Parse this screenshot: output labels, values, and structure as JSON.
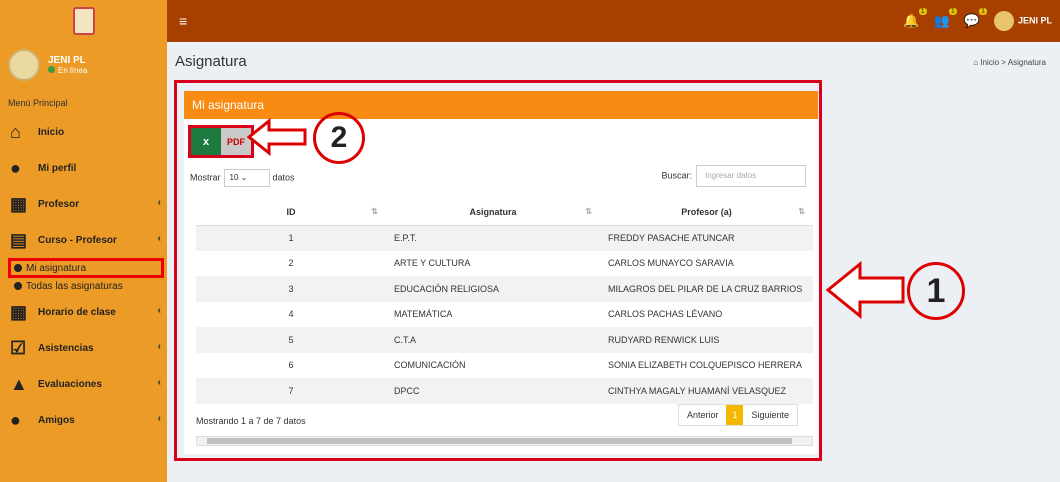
{
  "header": {
    "user": "JENI PL",
    "badges": [
      "1",
      "1",
      "1"
    ]
  },
  "sidebar": {
    "user_name": "JENI PL",
    "status": "En línea",
    "menu_title": "Menú Principal",
    "items": [
      {
        "label": "Inicio"
      },
      {
        "label": "Mi perfil"
      },
      {
        "label": "Profesor"
      },
      {
        "label": "Curso - Profesor"
      },
      {
        "label": "Horario de clase"
      },
      {
        "label": "Asistencias"
      },
      {
        "label": "Evaluaciones"
      },
      {
        "label": "Amigos"
      }
    ],
    "sub_items": [
      {
        "label": "Mi asignatura"
      },
      {
        "label": "Todas las asignaturas"
      }
    ]
  },
  "page": {
    "title": "Asignatura",
    "breadcrumb_home": "Inicio",
    "breadcrumb_current": "Asignatura"
  },
  "card": {
    "title": "Mi asignatura",
    "show_label": "Mostrar",
    "show_value": "10",
    "show_suffix": "datos",
    "search_label": "Buscar:",
    "search_placeholder": "Ingresar datos",
    "columns": [
      "ID",
      "Asignatura",
      "Profesor (a)"
    ],
    "rows": [
      {
        "id": "1",
        "asignatura": "E.P.T.",
        "profesor": "FREDDY PASACHE ATUNCAR"
      },
      {
        "id": "2",
        "asignatura": "ARTE Y CULTURA",
        "profesor": "CARLOS MUNAYCO SARAVIA"
      },
      {
        "id": "3",
        "asignatura": "EDUCACIÓN RELIGIOSA",
        "profesor": "MILAGROS DEL PILAR DE LA CRUZ BARRIOS"
      },
      {
        "id": "4",
        "asignatura": "MATEMÁTICA",
        "profesor": "CARLOS PACHAS LÉVANO"
      },
      {
        "id": "5",
        "asignatura": "C.T.A",
        "profesor": "RUDYARD RENWICK LUIS"
      },
      {
        "id": "6",
        "asignatura": "COMUNICACIÓN",
        "profesor": "SONIA ELIZABETH COLQUEPISCO HERRERA"
      },
      {
        "id": "7",
        "asignatura": "DPCC",
        "profesor": "CINTHYA MAGALY HUAMANÍ VELASQUEZ"
      }
    ],
    "info": "Mostrando 1 a 7 de 7 datos",
    "prev": "Anterior",
    "page": "1",
    "next": "Siguiente",
    "export_excel": "x",
    "export_pdf": "PDF"
  },
  "annotations": {
    "one": "1",
    "two": "2"
  }
}
